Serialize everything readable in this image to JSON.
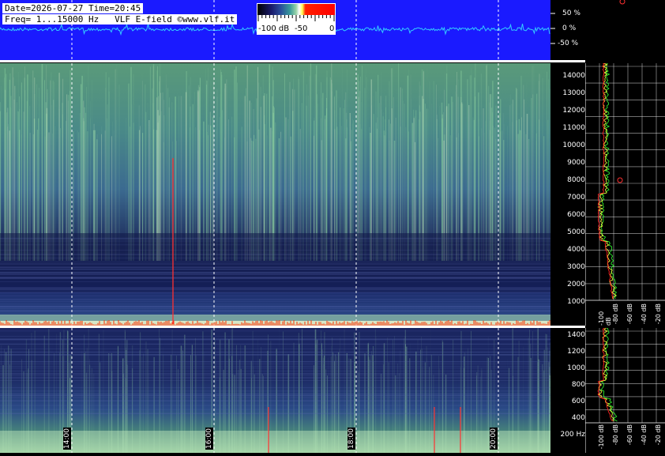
{
  "header": {
    "line1": "Date=2026-07-27 Time=20:45",
    "line2": "Freq= 1...15000 Hz   VLF E-field ©www.vlf.it"
  },
  "colorbar": {
    "labels": [
      "-100 dB",
      "-50",
      "0"
    ],
    "colors": [
      "#000000",
      "#2a4d9a",
      "#9ad4a8",
      "#ffffff",
      "#ffff50",
      "#ff0000"
    ]
  },
  "amplitude_scale": [
    "50 %",
    "0 %",
    "-50 %"
  ],
  "upper_freq_labels": [
    "14000",
    "13000",
    "12000",
    "11000",
    "10000",
    "9000",
    "8000",
    "7000",
    "6000",
    "5000",
    "4000",
    "3000",
    "2000",
    "1000"
  ],
  "lower_freq_labels": [
    "1400",
    "1200",
    "1000",
    "800",
    "600",
    "400",
    "200 Hz"
  ],
  "time_labels": [
    "14:00",
    "16:00",
    "18:00",
    "20:00"
  ],
  "db_labels": [
    "-100 dB",
    "-80 dB",
    "-60 dB",
    "-40 dB",
    "-20 dB"
  ],
  "colors": {
    "waveform_band": "#1a1aff",
    "waveform_trace": "#33ccff",
    "profile_mean": "#ffff40",
    "profile_peak": "#ff2020",
    "profile_min": "#30ff30",
    "grid": "#ffffff"
  }
}
